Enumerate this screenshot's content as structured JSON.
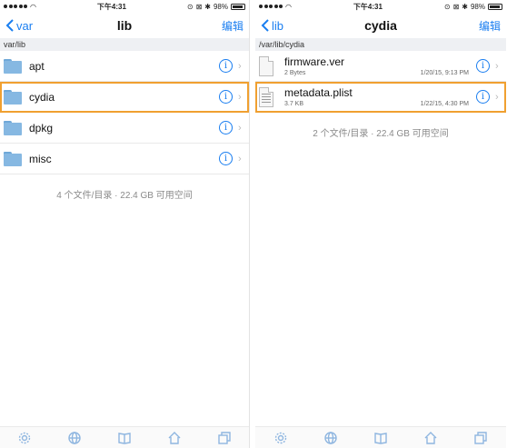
{
  "left": {
    "status": {
      "time": "下午4:31",
      "battery": "98%"
    },
    "nav": {
      "back": "var",
      "title": "lib",
      "edit": "编辑"
    },
    "path": "var/lib",
    "items": [
      {
        "name": "apt"
      },
      {
        "name": "cydia"
      },
      {
        "name": "dpkg"
      },
      {
        "name": "misc"
      }
    ],
    "summary": "4 个文件/目录 · 22.4 GB 可用空间"
  },
  "right": {
    "status": {
      "time": "下午4:31",
      "battery": "98%"
    },
    "nav": {
      "back": "lib",
      "title": "cydia",
      "edit": "编辑"
    },
    "path": "/var/lib/cydia",
    "files": [
      {
        "name": "firmware.ver",
        "size": "2 Bytes",
        "date": "1/20/15, 9:13 PM"
      },
      {
        "name": "metadata.plist",
        "size": "3.7 KB",
        "date": "1/22/15, 4:30 PM"
      }
    ],
    "summary": "2 个文件/目录 · 22.4 GB 可用空间"
  },
  "tabbar_icons": [
    "gear-icon",
    "globe-icon",
    "book-icon",
    "home-icon",
    "windows-icon"
  ],
  "colors": {
    "accent": "#1a7ef0",
    "highlight": "#f0a030"
  }
}
